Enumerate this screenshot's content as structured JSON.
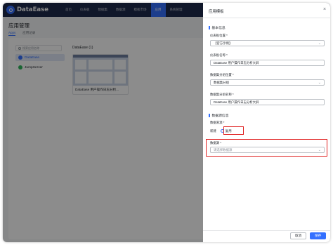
{
  "app": {
    "name": "DataEase"
  },
  "nav": {
    "items": [
      "首页",
      "仪表板",
      "数据集",
      "数据源",
      "模板市场",
      "应用",
      "系统管理"
    ],
    "active_index": 5
  },
  "page": {
    "title": "应用管理",
    "tabs": [
      "Apps",
      "应用记录"
    ],
    "search_placeholder": "搜索应用名称",
    "categories": [
      {
        "label": "DataEase",
        "color": "#3370ff"
      },
      {
        "label": "JumpServer",
        "color": "#2fb65c"
      }
    ],
    "section_title": "DataEase (1)",
    "card_title": "DataEase 用户操作日志分析..."
  },
  "drawer": {
    "title": "应用模板",
    "close_icon": "close-icon",
    "basic_section": "基本信息",
    "panel_location_label": "仪表板位置 *",
    "panel_location_value": "【官方示例】",
    "panel_name_label": "仪表板名称 *",
    "panel_name_value": "DataEase 用户操作日志分析大屏",
    "dataset_group_location_label": "数据集分组位置 *",
    "dataset_group_location_value": "数据集分组",
    "dataset_group_name_label": "数据集分组名称 *",
    "dataset_group_name_value": "DataEase 用户操作日志分析大屏",
    "datasource_section": "数据源信息",
    "datasource_from_label": "数据来源 *",
    "radio_new": "新建",
    "radio_reuse": "复用",
    "datasource_label": "数据源 *",
    "datasource_placeholder": "请选择数据源",
    "cancel_label": "取消",
    "confirm_label": "保存"
  },
  "colors": {
    "primary": "#3370ff",
    "nav_bg": "#1e2b4d",
    "highlight": "#e02020"
  }
}
